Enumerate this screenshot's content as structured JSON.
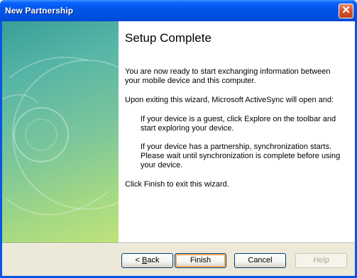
{
  "window": {
    "title": "New Partnership",
    "close_glyph": "✕"
  },
  "page": {
    "heading": "Setup Complete",
    "paragraphs": [
      "You are now ready to start exchanging information between your mobile device and this computer.",
      "Upon exiting this wizard, Microsoft ActiveSync will open and:",
      "If your device is a guest, click Explore on the toolbar and start exploring your device.",
      "If your device has a partnership, synchronization starts. Please wait until synchronization is complete before using your device.",
      "Click Finish to exit this wizard."
    ]
  },
  "buttons": {
    "back_arrow": "<",
    "back_mnemonic": "B",
    "back_rest": "ack",
    "finish": "Finish",
    "cancel": "Cancel",
    "help": "Help"
  },
  "colors": {
    "titlebar": "#0055e5",
    "close": "#d5522c",
    "sidebar_top": "#3a9e98",
    "sidebar_bottom": "#bfe37a"
  }
}
